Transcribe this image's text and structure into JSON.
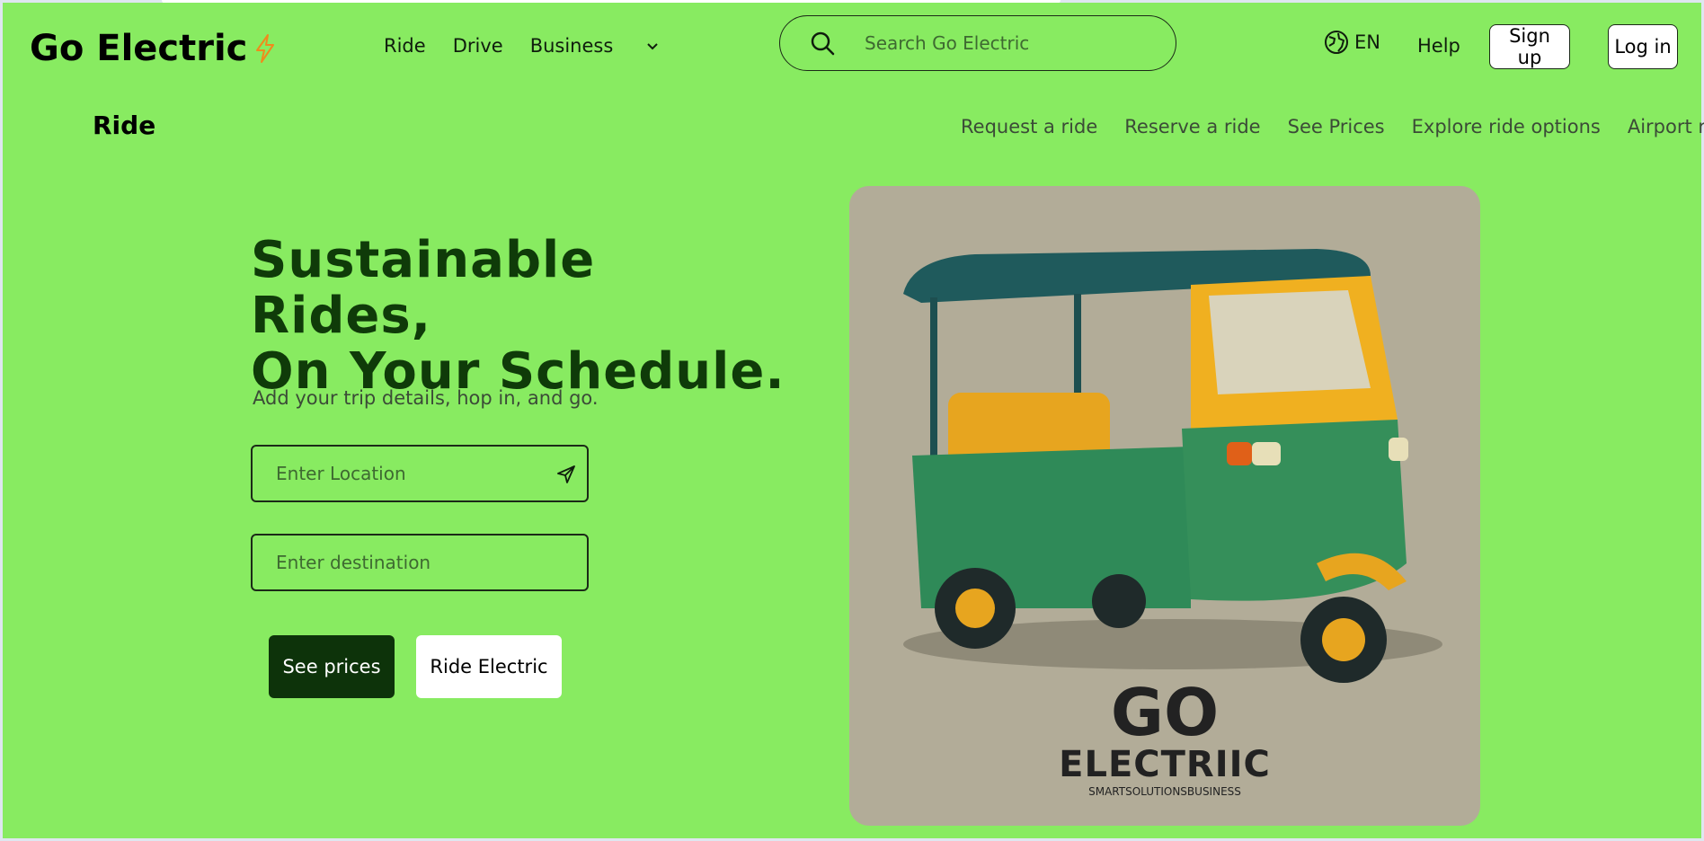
{
  "header": {
    "logo_text": "Go Electric",
    "nav": [
      "Ride",
      "Drive",
      "Business"
    ],
    "search_placeholder": "Search Go Electric",
    "language": "EN",
    "help": "Help",
    "signup": "Sign up",
    "login": "Log in"
  },
  "subnav": {
    "title": "Ride",
    "links": [
      "Request a ride",
      "Reserve a ride",
      "See Prices",
      "Explore ride options",
      "Airport rides"
    ]
  },
  "hero": {
    "title_line1": "Sustainable Rides,",
    "title_line2": "On Your Schedule.",
    "subtitle": "Add your trip details, hop in, and go.",
    "location_placeholder": "Enter Location",
    "destination_placeholder": "Enter destination",
    "see_prices": "See prices",
    "ride_electric": "Ride Electric"
  },
  "image": {
    "brand_go": "GO",
    "brand_name": "ELECTRIIC",
    "brand_tag": "SMARTSOLUTIONSBUSINESS"
  },
  "colors": {
    "page_bg": "#88eb61",
    "accent_dark": "#0d330a",
    "bolt_orange": "#f08a1c"
  },
  "icons": [
    "lightning-bolt-icon",
    "chevron-down-icon",
    "search-icon",
    "globe-icon",
    "send-icon"
  ]
}
